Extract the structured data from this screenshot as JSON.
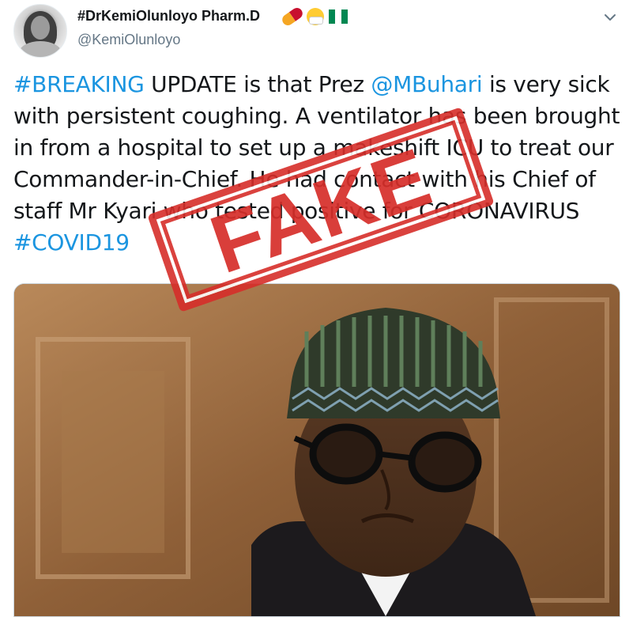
{
  "author": {
    "display_name": "#DrKemiOlunloyo Pharm.D",
    "handle": "@KemiOlunloyo",
    "name_icons": [
      "pill-icon",
      "face-mask-icon",
      "nigeria-flag-icon"
    ]
  },
  "tweet": {
    "lines": [
      [
        {
          "t": "#BREAKING",
          "link": true
        },
        {
          "t": " UPDATE is that Prez ",
          "link": false
        },
        {
          "t": "@MBuhari",
          "link": true
        },
        {
          "t": " is very sick",
          "link": false
        }
      ],
      [
        {
          "t": "with persistent coughing. A ventilator has been brought",
          "link": false
        }
      ],
      [
        {
          "t": "in from a  hospital to set up a makeshift ICU to treat our",
          "link": false
        }
      ],
      [
        {
          "t": "Commander-in-Chief. He had contact with his Chief of",
          "link": false
        }
      ],
      [
        {
          "t": "staff Mr Kyari who tested positive for CORONAVIRUS",
          "link": false
        }
      ],
      [
        {
          "t": "#COVID19",
          "link": true
        }
      ]
    ]
  },
  "stamp": {
    "text": "FAKE",
    "color": "#d62e2a"
  },
  "media": {
    "description_icon": "photo"
  },
  "colors": {
    "link": "#1b95e0",
    "text": "#14171a",
    "secondary": "#657786"
  }
}
